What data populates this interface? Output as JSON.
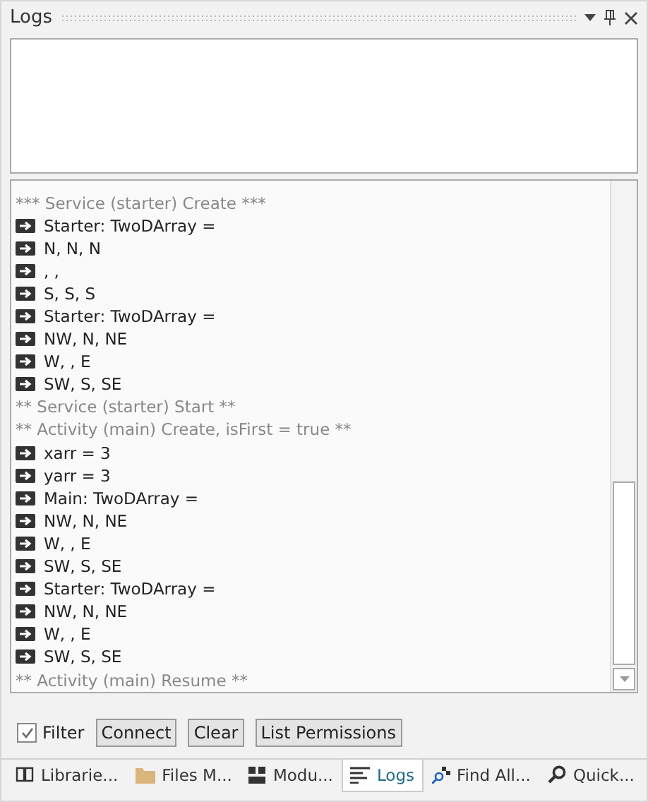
{
  "panel": {
    "title": "Logs"
  },
  "log_lines": [
    {
      "kind": "header",
      "text": "*** Service (starter) Create ***"
    },
    {
      "kind": "output",
      "text": "Starter: TwoDArray ="
    },
    {
      "kind": "output",
      "text": "N, N, N"
    },
    {
      "kind": "output",
      "text": ", ,"
    },
    {
      "kind": "output",
      "text": "S, S, S"
    },
    {
      "kind": "output",
      "text": "Starter: TwoDArray ="
    },
    {
      "kind": "output",
      "text": "NW, N, NE"
    },
    {
      "kind": "output",
      "text": "W, , E"
    },
    {
      "kind": "output",
      "text": "SW, S, SE"
    },
    {
      "kind": "header",
      "text": "** Service (starter) Start **"
    },
    {
      "kind": "header",
      "text": "** Activity (main) Create, isFirst = true **"
    },
    {
      "kind": "output",
      "text": "xarr = 3"
    },
    {
      "kind": "output",
      "text": "yarr = 3"
    },
    {
      "kind": "output",
      "text": "Main: TwoDArray ="
    },
    {
      "kind": "output",
      "text": "NW, N, NE"
    },
    {
      "kind": "output",
      "text": "W, , E"
    },
    {
      "kind": "output",
      "text": "SW, S, SE"
    },
    {
      "kind": "output",
      "text": "Starter: TwoDArray ="
    },
    {
      "kind": "output",
      "text": "NW, N, NE"
    },
    {
      "kind": "output",
      "text": "W, , E"
    },
    {
      "kind": "output",
      "text": "SW, S, SE"
    },
    {
      "kind": "header",
      "text": "** Activity (main) Resume **"
    }
  ],
  "filter": {
    "label": "Filter",
    "checked": true
  },
  "buttons": [
    "Connect",
    "Clear",
    "List Permissions"
  ],
  "tabs": [
    {
      "kind": "book",
      "label": "Librarie...",
      "selected": false
    },
    {
      "kind": "folder",
      "label": "Files M...",
      "selected": false
    },
    {
      "kind": "modules",
      "label": "Modu...",
      "selected": false
    },
    {
      "kind": "lines",
      "label": "Logs",
      "selected": true
    },
    {
      "kind": "find",
      "label": "Find All...",
      "selected": false
    },
    {
      "kind": "magnifier",
      "label": "Quick...",
      "selected": false
    }
  ]
}
